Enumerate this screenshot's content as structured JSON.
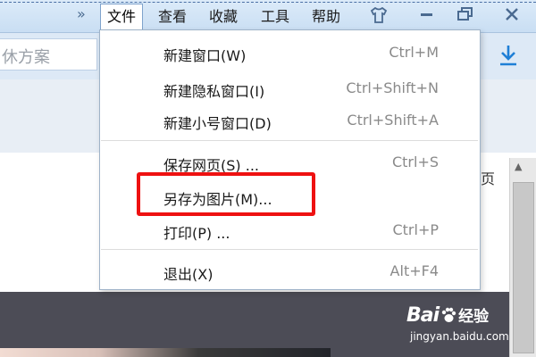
{
  "menubar": {
    "chevron": "»",
    "items": [
      "文件",
      "查看",
      "收藏",
      "工具",
      "帮助"
    ],
    "active_index": 0,
    "window_icons": {
      "skin": "shirt-icon",
      "minimize": "–",
      "restore": "restore-icon",
      "close": "✕"
    }
  },
  "search": {
    "placeholder_fragment": "休方案"
  },
  "page": {
    "stray_text": "页"
  },
  "file_menu": {
    "groups": [
      [
        {
          "label": "新建窗口(W)",
          "shortcut": "Ctrl+M"
        },
        {
          "label": "新建隐私窗口(I)",
          "shortcut": "Ctrl+Shift+N"
        },
        {
          "label": "新建小号窗口(D)",
          "shortcut": "Ctrl+Shift+A"
        }
      ],
      [
        {
          "label": "保存网页(S) ...",
          "shortcut": "Ctrl+S"
        },
        {
          "label": "另存为图片(M)...",
          "shortcut": ""
        },
        {
          "label": "打印(P) ...",
          "shortcut": "Ctrl+P"
        }
      ],
      [
        {
          "label": "退出(X)",
          "shortcut": "Alt+F4"
        }
      ]
    ],
    "highlighted_item": "另存为图片(M)..."
  },
  "watermark": {
    "logo": "Bai",
    "logo_suffix": "经验",
    "url": "jingyan.baidu.com"
  },
  "colors": {
    "highlight_border": "#ee1111",
    "menubar_bg": "#d3e5f7"
  }
}
